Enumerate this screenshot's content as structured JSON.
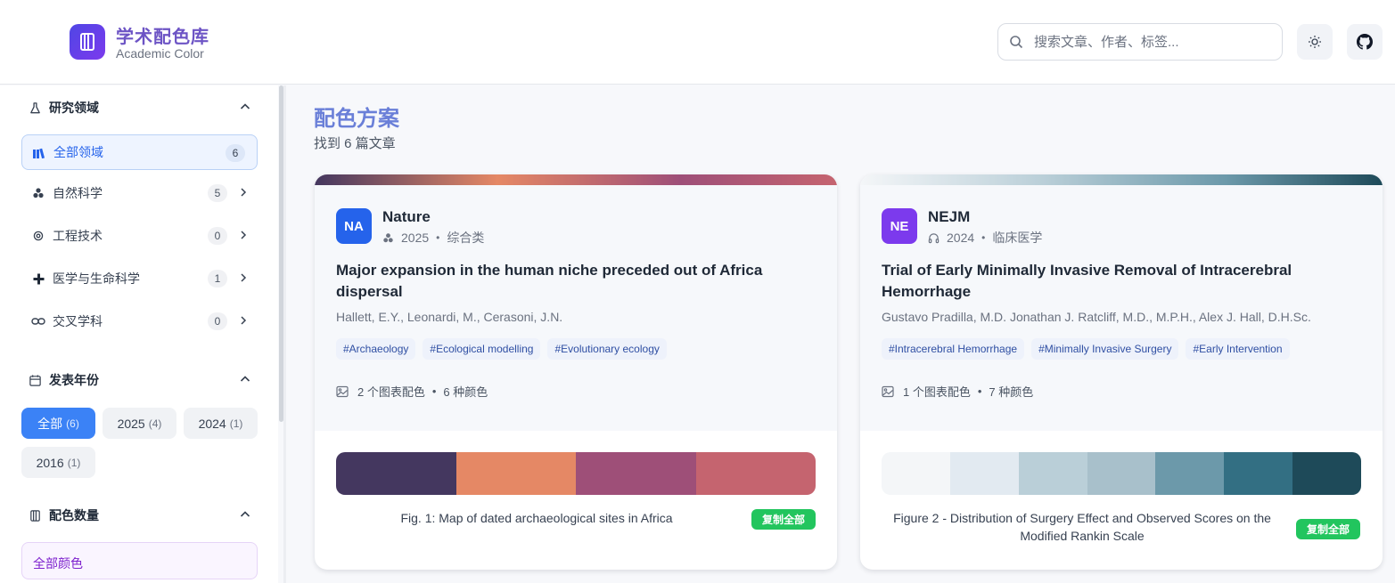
{
  "header": {
    "app_title": "学术配色库",
    "app_subtitle": "Academic Color",
    "search_placeholder": "搜索文章、作者、标签..."
  },
  "sidebar": {
    "fields_title": "研究领域",
    "fields": [
      {
        "label": "全部领域",
        "count": "6",
        "icon": "books-icon",
        "active": true
      },
      {
        "label": "自然科学",
        "count": "5",
        "icon": "atom-icon"
      },
      {
        "label": "工程技术",
        "count": "0",
        "icon": "gear-icon"
      },
      {
        "label": "医学与生命科学",
        "count": "1",
        "icon": "plus-icon"
      },
      {
        "label": "交叉学科",
        "count": "0",
        "icon": "link-icon"
      }
    ],
    "years_title": "发表年份",
    "years": [
      {
        "label": "全部",
        "count": "(6)",
        "active": true
      },
      {
        "label": "2025",
        "count": "(4)"
      },
      {
        "label": "2024",
        "count": "(1)"
      },
      {
        "label": "2016",
        "count": "(1)"
      }
    ],
    "colors_title": "配色数量",
    "colors_all": "全部颜色"
  },
  "main": {
    "title": "配色方案",
    "subtitle": "找到 6 篇文章"
  },
  "cards": [
    {
      "badge": "NA",
      "badge_color": "#2563eb",
      "journal": "Nature",
      "year": "2025",
      "category": "综合类",
      "title": "Major expansion in the human niche preceded out of Africa dispersal",
      "authors": "Hallett, E.Y., Leonardi, M., Cerasoni, J.N.",
      "tags": [
        "#Archaeology",
        "#Ecological modelling",
        "#Evolutionary ecology"
      ],
      "charts": "2 个图表配色",
      "colors_count": "6 种颜色",
      "palette": [
        "#44375f",
        "#e58865",
        "#9e4f78",
        "#c5646f"
      ],
      "caption": "Fig. 1: Map of dated archaeological sites in Africa",
      "copy_label": "复制全部"
    },
    {
      "badge": "NE",
      "badge_color": "#7c3aed",
      "journal": "NEJM",
      "year": "2024",
      "category": "临床医学",
      "title": "Trial of Early Minimally Invasive Removal of Intracerebral Hemorrhage",
      "authors": "Gustavo Pradilla, M.D. Jonathan J. Ratcliff, M.D., M.P.H., Alex J. Hall, D.H.Sc.",
      "tags": [
        "#Intracerebral Hemorrhage",
        "#Minimally Invasive Surgery",
        "#Early Intervention"
      ],
      "charts": "1 个图表配色",
      "colors_count": "7 种颜色",
      "palette": [
        "#f4f6f8",
        "#e2eaf1",
        "#bacfd8",
        "#a8c0cb",
        "#6c99aa",
        "#336f83",
        "#1e4a59"
      ],
      "caption": "Figure 2 - Distribution of Surgery Effect and Observed Scores on the Modified Rankin Scale",
      "copy_label": "复制全部"
    }
  ]
}
